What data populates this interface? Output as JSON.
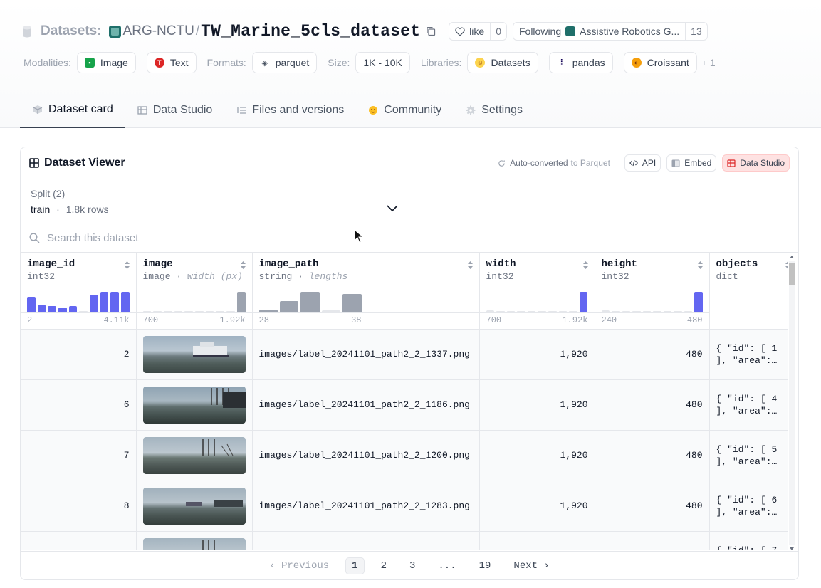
{
  "header": {
    "section_label": "Datasets:",
    "org": "ARG-NCTU",
    "separator": "/",
    "repo": "TW_Marine_5cls_dataset",
    "like_label": "like",
    "like_count": "0",
    "following_label": "Following",
    "following_org": "Assistive Robotics G...",
    "following_count": "13"
  },
  "meta": {
    "modalities_label": "Modalities:",
    "modalities": [
      "Image",
      "Text"
    ],
    "formats_label": "Formats:",
    "format": "parquet",
    "size_label": "Size:",
    "size": "1K - 10K",
    "libraries_label": "Libraries:",
    "libraries": [
      "Datasets",
      "pandas",
      "Croissant"
    ],
    "more": "+ 1"
  },
  "tabs": [
    {
      "label": "Dataset card",
      "icon": "cube-icon",
      "active": true
    },
    {
      "label": "Data Studio",
      "icon": "table-icon"
    },
    {
      "label": "Files and versions",
      "icon": "files-icon"
    },
    {
      "label": "Community",
      "icon": "hug-icon"
    },
    {
      "label": "Settings",
      "icon": "gear-icon"
    }
  ],
  "viewer": {
    "title": "Dataset Viewer",
    "auto_link": "Auto-converted",
    "auto_rest": "to Parquet",
    "api_label": "API",
    "embed_label": "Embed",
    "studio_label": "Data Studio",
    "split_label": "Split (2)",
    "split_value": "train",
    "split_dot": "·",
    "split_rows": "1.8k rows",
    "search_placeholder": "Search this dataset"
  },
  "columns": [
    {
      "name": "image_id",
      "type": "int32",
      "hist": [
        0.75,
        0.35,
        0.3,
        0.22,
        0.28,
        0.0,
        0.85,
        1.0,
        1.0,
        1.0
      ],
      "hist_color": "#6366f1",
      "min": "2",
      "max": "4.11k"
    },
    {
      "name": "image",
      "type": "image",
      "type_extra": "width (px)",
      "hist": [
        0.04,
        0.04,
        0.04,
        0.04,
        0.04,
        0.04,
        0.04,
        0.04,
        0.04,
        1.0
      ],
      "hist_color": "#9ca3af",
      "min": "700",
      "max": "1.92k"
    },
    {
      "name": "image_path",
      "type": "string",
      "type_extra": "lengths",
      "hist": [
        0.12,
        0.55,
        1.0,
        0.06,
        0.88
      ],
      "hist_color": "#9ca3af",
      "min": "28",
      "max": "38"
    },
    {
      "name": "width",
      "type": "int32",
      "hist": [
        0.06,
        0.04,
        0.04,
        0.04,
        0.04,
        0.04,
        0.04,
        0.04,
        0.04,
        1.0
      ],
      "hist_color": "#6366f1",
      "min": "700",
      "max": "1.92k"
    },
    {
      "name": "height",
      "type": "int32",
      "hist": [
        0.06,
        0.04,
        0.04,
        0.04,
        0.04,
        0.04,
        0.04,
        0.04,
        0.04,
        1.0
      ],
      "hist_color": "#6366f1",
      "min": "240",
      "max": "480"
    },
    {
      "name": "objects",
      "type": "dict"
    }
  ],
  "rows": [
    {
      "image_id": "2",
      "path": "images/label_20241101_path2_2_1337.png",
      "width": "1,920",
      "height": "480",
      "obj1": "{ \"id\": [ 1",
      "obj2": "], \"area\":…"
    },
    {
      "image_id": "6",
      "path": "images/label_20241101_path2_2_1186.png",
      "width": "1,920",
      "height": "480",
      "obj1": "{ \"id\": [ 4",
      "obj2": "], \"area\":…"
    },
    {
      "image_id": "7",
      "path": "images/label_20241101_path2_2_1200.png",
      "width": "1,920",
      "height": "480",
      "obj1": "{ \"id\": [ 5",
      "obj2": "], \"area\":…"
    },
    {
      "image_id": "8",
      "path": "images/label_20241101_path2_2_1283.png",
      "width": "1,920",
      "height": "480",
      "obj1": "{ \"id\": [ 6",
      "obj2": "], \"area\":…"
    },
    {
      "image_id": "",
      "path": "",
      "width": "",
      "height": "",
      "obj1": "{ \"id\": [ 7",
      "obj2": ""
    }
  ],
  "pager": {
    "prev": "Previous",
    "pages": [
      "1",
      "2",
      "3",
      "...",
      "19"
    ],
    "next": "Next"
  }
}
